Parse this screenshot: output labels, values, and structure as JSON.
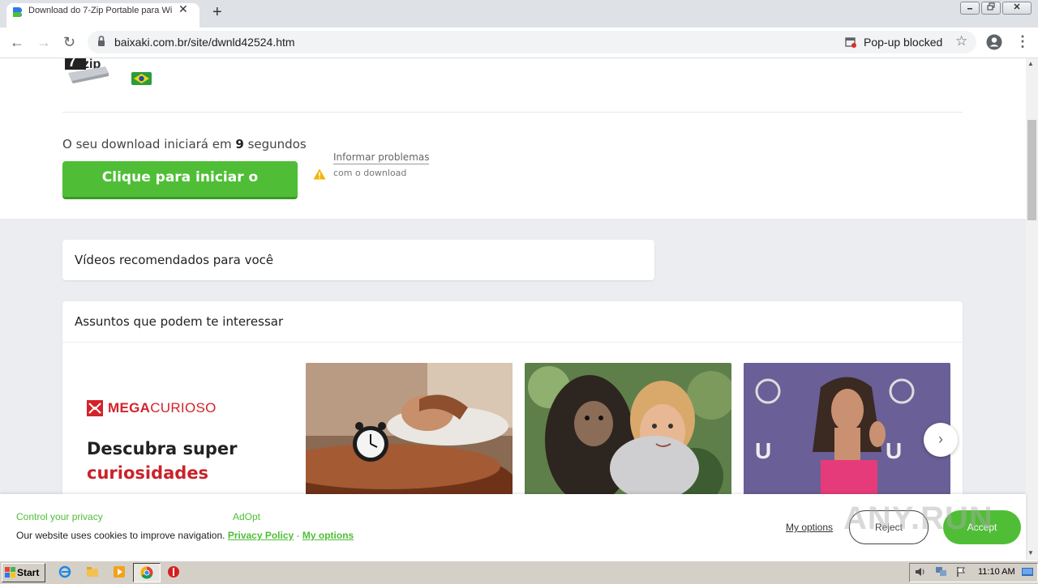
{
  "browser": {
    "tab_title": "Download do 7-Zip Portable para Wi",
    "tab_close": "✕",
    "new_tab": "+",
    "url": "baixaki.com.br/site/dwnld42524.htm",
    "popup_blocked": "Pop-up blocked",
    "star": "☆",
    "menu": "⋮",
    "nav_back": "←",
    "nav_forward": "→",
    "nav_reload": "↻"
  },
  "page": {
    "countdown_prefix": "O seu download iniciará em ",
    "countdown_seconds": "9",
    "countdown_suffix": " segundos",
    "download_button": "Clique para iniciar o download",
    "report_problems": "Informar problemas",
    "report_sub": "com o download",
    "videos_title": "Vídeos recomendados para você",
    "topics_title": "Assuntos que podem te interessar",
    "mega_logo_a": "MEGA",
    "mega_logo_b": "CURIOSO",
    "promo_line1": "Descubra super",
    "promo_line2": "curiosidades",
    "carousel_next": "›"
  },
  "cookie": {
    "title": "Control your privacy",
    "brand": "AdOpt",
    "text": "Our website uses cookies to improve navigation.",
    "privacy_policy": "Privacy Policy",
    "separator": "-",
    "my_options_inline": "My options",
    "my_options": "My options",
    "reject": "Reject",
    "accept": "Accept"
  },
  "watermark": "ANY.RUN",
  "taskbar": {
    "start": "Start",
    "clock": "11:10 AM"
  },
  "colors": {
    "accent_green": "#4fbe36",
    "mega_red": "#d3232a"
  }
}
